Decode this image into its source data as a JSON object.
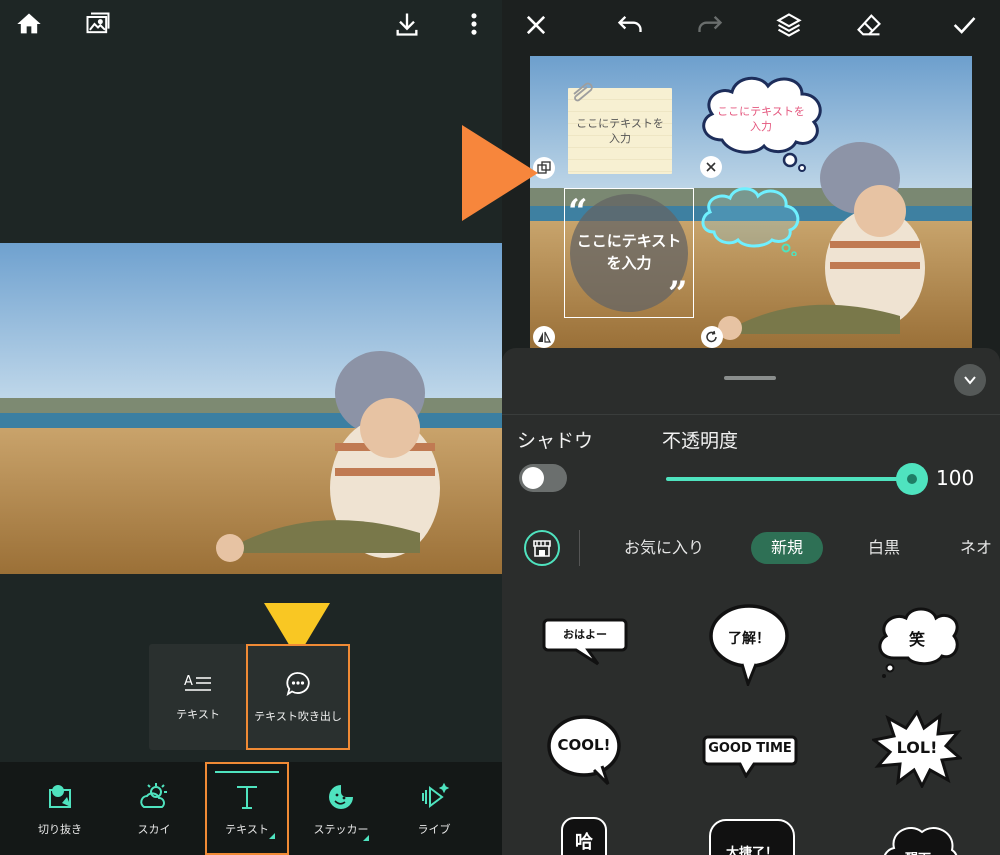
{
  "left": {
    "text_menu": {
      "text_label": "テキスト",
      "balloon_label": "テキスト吹き出し"
    },
    "tools": [
      {
        "label": "切り抜き"
      },
      {
        "label": "スカイ"
      },
      {
        "label": "テキスト"
      },
      {
        "label": "ステッカー"
      },
      {
        "label": "ライブ"
      }
    ]
  },
  "right": {
    "canvas": {
      "note_text": "ここにテキストを入力",
      "cloud_text": "ここにテキストを入力",
      "circle_text": "ここにテキストを入力",
      "quote_open": "“",
      "quote_close": "”"
    },
    "sheet": {
      "shadow_label": "シャドウ",
      "shadow_on": false,
      "opacity_label": "不透明度",
      "opacity_value": "100",
      "categories": [
        "お気に入り",
        "新規",
        "白黒",
        "ネオ"
      ],
      "selected_category": "新規",
      "stickers": [
        "おはよー",
        "了解！",
        "笑",
        "COOL!",
        "GOOD TIME",
        "LOL!",
        "哈",
        "大捷了！",
        "醒下"
      ]
    }
  },
  "colors": {
    "accent": "#4fe3bf",
    "highlight_orange": "#f08a35",
    "pointer_yellow": "#f9c723",
    "selected_chip": "#2e7055"
  }
}
